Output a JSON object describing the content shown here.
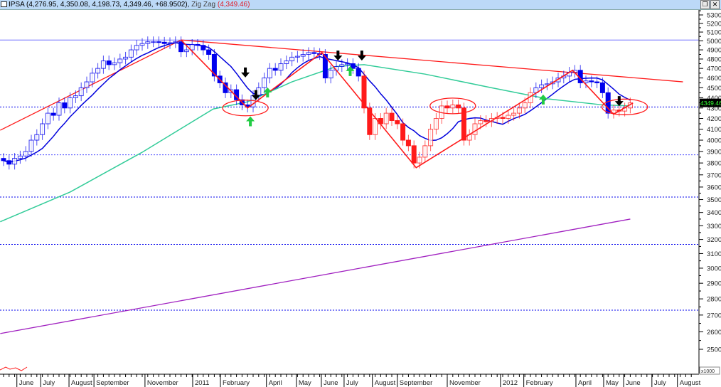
{
  "header": {
    "symbol": "IPSA",
    "ohlc_text": "(4,276.95, 4,350.08, 4,198.73, 4,349.46, +68.9502),",
    "indicator": "Zig Zag",
    "indicator_value": "(4,349.46)",
    "buttons": [
      "restore-icon",
      "close-icon"
    ],
    "restore_glyph": "❐",
    "close_glyph": "✕"
  },
  "chart_data": {
    "type": "candlestick",
    "title": "IPSA",
    "scale": "log",
    "ylim": [
      2500,
      5300
    ],
    "yticks": [
      2500,
      2600,
      2700,
      2800,
      2900,
      3000,
      3100,
      3200,
      3300,
      3400,
      3500,
      3600,
      3700,
      3800,
      3900,
      4000,
      4100,
      4200,
      4300,
      4400,
      4500,
      4600,
      4700,
      4800,
      4900,
      5000,
      5100,
      5200,
      5300
    ],
    "y_multiplier_label": "x1000",
    "last_price_label": "4349.46",
    "period": "weekly",
    "closes": [
      3820,
      3790,
      3840,
      3860,
      3900,
      4000,
      4050,
      4150,
      4250,
      4230,
      4350,
      4300,
      4400,
      4420,
      4500,
      4560,
      4650,
      4700,
      4780,
      4740,
      4760,
      4800,
      4820,
      4900,
      4950,
      4970,
      4990,
      4990,
      4985,
      4970,
      4980,
      4990,
      4880,
      4900,
      4960,
      4950,
      4900,
      4850,
      4620,
      4550,
      4450,
      4480,
      4380,
      4330,
      4310,
      4420,
      4500,
      4600,
      4700,
      4680,
      4750,
      4780,
      4820,
      4830,
      4850,
      4870,
      4860,
      4850,
      4600,
      4680,
      4720,
      4740,
      4750,
      4700,
      4620,
      4300,
      4050,
      4200,
      4150,
      4250,
      4180,
      4150,
      4000,
      3950,
      3800,
      3850,
      3950,
      4100,
      4200,
      4320,
      4300,
      4330,
      4300,
      4000,
      4050,
      4150,
      4180,
      4170,
      4200,
      4210,
      4200,
      4230,
      4250,
      4300,
      4350,
      4450,
      4500,
      4530,
      4540,
      4560,
      4600,
      4620,
      4660,
      4680,
      4550,
      4570,
      4560,
      4550,
      4450,
      4250,
      4280,
      4270,
      4300,
      4349.46
    ],
    "color_regimes": [
      {
        "from": 0,
        "to": 64,
        "color": "#0000ee"
      },
      {
        "from": 65,
        "to": 95,
        "color": "#ff1a1a"
      },
      {
        "from": 96,
        "to": 109,
        "color": "#0000ee"
      },
      {
        "from": 110,
        "to": 113,
        "color": "#ff1a1a"
      }
    ],
    "x_labels": [
      {
        "label": "June",
        "week": 2.4
      },
      {
        "label": "July",
        "week": 6.7
      },
      {
        "label": "August",
        "week": 11.8
      },
      {
        "label": "September",
        "week": 16.3
      },
      {
        "label": "November",
        "week": 25.5
      },
      {
        "label": "2011",
        "week": 34.1
      },
      {
        "label": "February",
        "week": 39.1
      },
      {
        "label": "April",
        "week": 47.4
      },
      {
        "label": "May",
        "week": 52.8
      },
      {
        "label": "June",
        "week": 57.3
      },
      {
        "label": "July",
        "week": 61.4
      },
      {
        "label": "August",
        "week": 66.5
      },
      {
        "label": "September",
        "week": 71
      },
      {
        "label": "November",
        "week": 80
      },
      {
        "label": "2012",
        "week": 89.6
      },
      {
        "label": "February",
        "week": 93.8
      },
      {
        "label": "April",
        "week": 103.2
      },
      {
        "label": "May",
        "week": 108.2
      },
      {
        "label": "June",
        "week": 111.8
      },
      {
        "label": "July",
        "week": 116.9
      },
      {
        "label": "August",
        "week": 121.5
      }
    ],
    "horizontal_levels": [
      {
        "value": 5010,
        "style": "solid",
        "color": "#6f6fff"
      },
      {
        "value": 4310,
        "style": "dotted",
        "color": "#0000ee"
      },
      {
        "value": 3870,
        "style": "dotted",
        "color": "#4444ff"
      },
      {
        "value": 3520,
        "style": "dotted",
        "color": "#0000ee"
      },
      {
        "value": 3165,
        "style": "dotted",
        "color": "#0000ee"
      },
      {
        "value": 2730,
        "style": "dotted",
        "color": "#0000ee"
      }
    ],
    "trendlines": [
      {
        "name": "resistance",
        "color": "#ff1a1a",
        "points": [
          [
            32,
            5010
          ],
          [
            122.5,
            4560
          ]
        ]
      },
      {
        "name": "support-uptrend",
        "color": "#ff1a1a",
        "points": [
          [
            -0.6,
            4090
          ],
          [
            32,
            5010
          ]
        ]
      },
      {
        "name": "long-trend",
        "color": "#a020c0",
        "points": [
          [
            -0.6,
            2590
          ],
          [
            113,
            3350
          ]
        ]
      }
    ],
    "zigzag": {
      "color": "#ff1a1a",
      "points": [
        [
          32,
          5010
        ],
        [
          44,
          4300
        ],
        [
          57.4,
          4870
        ],
        [
          74.4,
          3760
        ],
        [
          102.6,
          4680
        ],
        [
          110,
          4240
        ],
        [
          113.5,
          4349.46
        ]
      ]
    },
    "moving_averages": [
      {
        "name": "short-ma",
        "color": "#0000dd",
        "period": 8
      },
      {
        "name": "long-ma",
        "color": "#33cc99",
        "points": [
          [
            -0.6,
            3330
          ],
          [
            12,
            3560
          ],
          [
            24.9,
            3890
          ],
          [
            37.8,
            4290
          ],
          [
            44,
            4360
          ],
          [
            52,
            4560
          ],
          [
            60,
            4720
          ],
          [
            65,
            4740
          ],
          [
            76,
            4640
          ],
          [
            88,
            4500
          ],
          [
            98,
            4390
          ],
          [
            108,
            4330
          ],
          [
            113,
            4320
          ]
        ]
      }
    ],
    "ellipses": [
      {
        "week": 43.6,
        "value": 4300
      },
      {
        "week": 81,
        "value": 4320
      },
      {
        "week": 112,
        "value": 4310
      }
    ],
    "signals": [
      {
        "type": "down",
        "week": 43.6,
        "value": 4650,
        "color": "#000000"
      },
      {
        "type": "down",
        "week": 45.5,
        "value": 4420,
        "color": "#000000"
      },
      {
        "type": "down",
        "week": 60.3,
        "value": 4830,
        "color": "#000000"
      },
      {
        "type": "down",
        "week": 64.6,
        "value": 4830,
        "color": "#000000"
      },
      {
        "type": "down",
        "week": 111,
        "value": 4360,
        "color": "#000000"
      },
      {
        "type": "up",
        "week": 44.5,
        "value": 4180,
        "color": "#22cc44"
      },
      {
        "type": "up",
        "week": 47.6,
        "value": 4460,
        "color": "#22cc44"
      },
      {
        "type": "up",
        "week": 62.5,
        "value": 4680,
        "color": "#22cc44"
      },
      {
        "type": "up",
        "week": 97.3,
        "value": 4390,
        "color": "#22cc44"
      }
    ]
  }
}
